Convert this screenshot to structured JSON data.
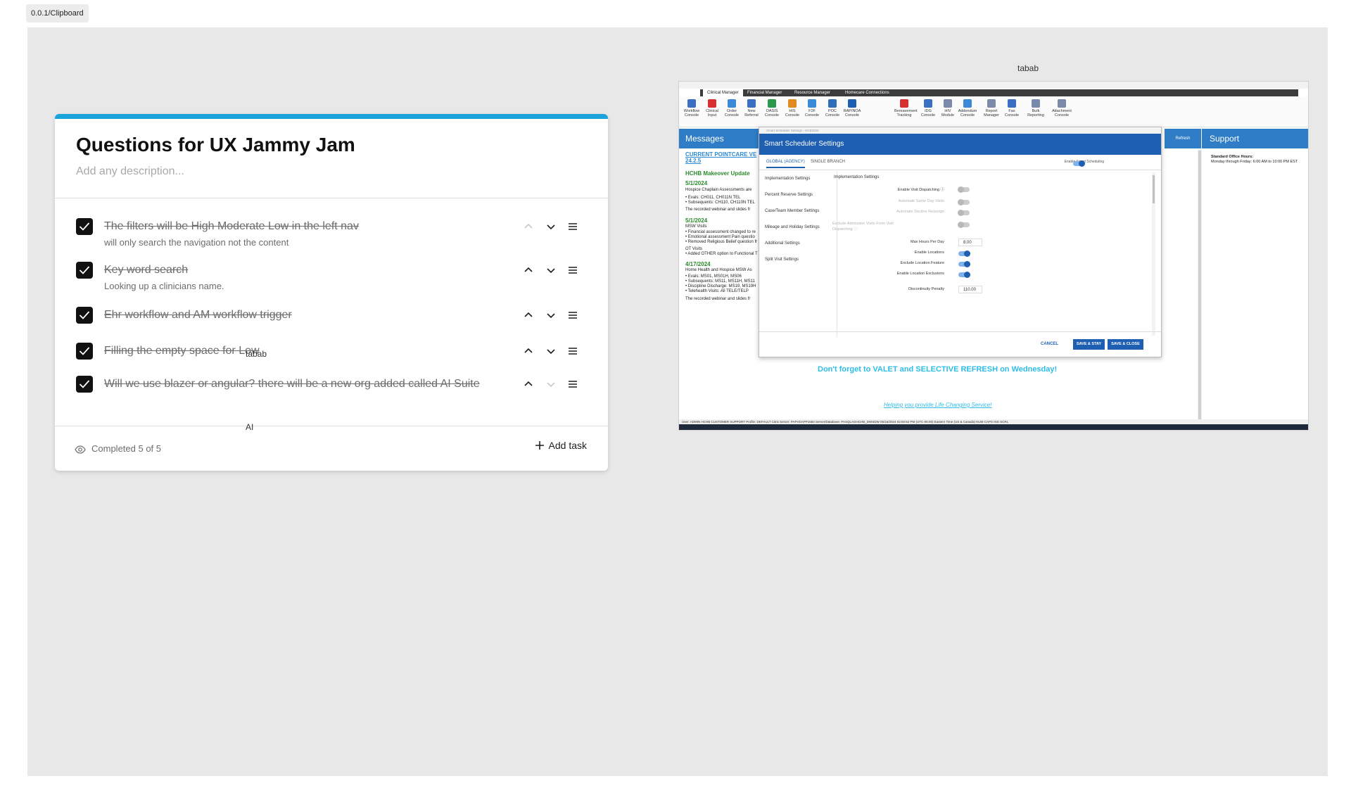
{
  "frame_label": "0.0.1/Clipboard",
  "stray_labels": {
    "top": "tabab",
    "mid": "tabab",
    "ai": "AI"
  },
  "card": {
    "title": "Questions for UX Jammy Jam",
    "description_placeholder": "Add any description...",
    "tasks": [
      {
        "title": "The filters will be High Moderate Low in the left nav",
        "note": "will only search the navigation not the content",
        "checked": true
      },
      {
        "title": "Key word search",
        "note": "Looking up a clinicians name.",
        "checked": true
      },
      {
        "title": "Ehr workflow and AM  workflow trigger",
        "note": "",
        "checked": true
      },
      {
        "title": "Filling the empty space for Low",
        "note": "",
        "checked": true
      },
      {
        "title": "Will we use blazer or angular? there will be a new org added called AI Suite",
        "note": "",
        "checked": true
      }
    ],
    "footer": {
      "completed": "Completed 5 of 5",
      "add_task": "Add task"
    },
    "icons": {
      "move_up": "chevron-up-icon",
      "move_down": "chevron-down-icon",
      "menu": "hamburger-menu-icon",
      "visibility": "eye-icon",
      "add": "plus-icon"
    }
  },
  "screenshot": {
    "tabs": [
      "Clinical Manager",
      "Financial Manager",
      "Resource Manager",
      "Homecare Connections"
    ],
    "ribbon": [
      {
        "label": "Workflow Console",
        "color": "#3b6fc4"
      },
      {
        "label": "Clinical Input",
        "color": "#d83030"
      },
      {
        "label": "Order Console",
        "color": "#3b8ad8"
      },
      {
        "label": "New Referral",
        "color": "#3b6fc4"
      },
      {
        "label": "OASIS Console",
        "color": "#2a9a4a"
      },
      {
        "label": "HIS Console",
        "color": "#e08a20"
      },
      {
        "label": "F2F Console",
        "color": "#3b8ad8"
      },
      {
        "label": "POC Console",
        "color": "#2f6fb8"
      },
      {
        "label": "RAP/NOA Console",
        "color": "#1f5fb1"
      },
      {
        "label": "Bereavement Tracking",
        "color": "#d83030"
      },
      {
        "label": "IDG Console",
        "color": "#3b6fc4"
      },
      {
        "label": "HIV Module",
        "color": "#7a8aa8"
      },
      {
        "label": "Addendum Console",
        "color": "#3b8ad8"
      },
      {
        "label": "Report Manager",
        "color": "#7a8aa8"
      },
      {
        "label": "Fax Console",
        "color": "#3b6fc4"
      },
      {
        "label": "Bulk Reporting",
        "color": "#7a8aa8"
      },
      {
        "label": "Attachment Console",
        "color": "#7a8aa8"
      }
    ],
    "messages_header": "Messages",
    "refresh": "Refresh",
    "support_header": "Support",
    "support_lines": [
      "Standard Office Hours:",
      "Monday through Friday: 6:00 AM to 10:00 PM EST"
    ],
    "messages": [
      {
        "text": "CURRENT POINTCARE VE",
        "style": "blue"
      },
      {
        "text": "24.2.5",
        "style": "blue"
      },
      {
        "text": "HCHB Makeover Update",
        "style": "green"
      },
      {
        "text": "5/1/2024",
        "style": "green"
      },
      {
        "text": "Hospice Chaplain Assessments are",
        "style": "plain"
      },
      {
        "text": "• Evals: CH011, CH011N TEL",
        "style": "plain"
      },
      {
        "text": "• Subsequents: CH110, CH110N TEL",
        "style": "plain"
      },
      {
        "text": "The recorded webinar and slides fr",
        "style": "plain"
      },
      {
        "text": "5/1/2024",
        "style": "green"
      },
      {
        "text": "MSW Visits",
        "style": "plain"
      },
      {
        "text": "• Financial assessment changed to re",
        "style": "plain"
      },
      {
        "text": "• Emotional assessment Pain questio",
        "style": "plain"
      },
      {
        "text": "• Removed Religious Belief question fr",
        "style": "plain"
      },
      {
        "text": "OT Visits",
        "style": "plain"
      },
      {
        "text": "• Added OTHER option to Functional T",
        "style": "plain"
      },
      {
        "text": "4/17/2024",
        "style": "green"
      },
      {
        "text": "Home Health and Hospice MSW As",
        "style": "plain"
      },
      {
        "text": "• Evals: MS01, MS01H, MS06",
        "style": "plain"
      },
      {
        "text": "• Subsequents: MS11, MS11H, MS11",
        "style": "plain"
      },
      {
        "text": "• Discipline Discharge: MS19, MS19H",
        "style": "plain"
      },
      {
        "text": "• Telehealth Visits: All TELE/TELP",
        "style": "plain"
      },
      {
        "text": "The recorded webinar and slides fr",
        "style": "plain"
      }
    ],
    "reminder": "Don't forget to VALET and SELECTIVE REFRESH on Wednesday!",
    "tagline": "Helping you provide Life Changing Service!",
    "status_bar": "User: ADMIN HCHB  CUSTOMER SUPPORT   Profile: DEFAULT   Citrix Server: PAPVDAPP1560   Server/Database: PASQLAGHCHB_DWSDW   05/16/2024 02:50:52 PM (UTC-05:00) Eastern Time (US & Canada)   NUM   CAPS   INS   SCRL",
    "dialog": {
      "window_title": "Smart Scheduler Settings - HCB2024",
      "header": "Smart Scheduler Settings",
      "tabs": [
        "GLOBAL (AGENCY)",
        "SINGLE BRANCH"
      ],
      "enable_label": "Enable Smart Scheduling",
      "menu": [
        "Implementation Settings",
        "Percent Reserve Settings",
        "Case/Team Member Settings",
        "Mileage and Holiday Settings",
        "Additional Settings",
        "Split Visit Settings"
      ],
      "section": "Implementation Settings",
      "settings": [
        {
          "label": "Enable Visit Dispatching ⓘ",
          "kind": "toggle",
          "on": false,
          "dim": false
        },
        {
          "label": "Automate Same Day Visits",
          "kind": "toggle",
          "on": false,
          "dim": true
        },
        {
          "label": "Automate Decline Reassign",
          "kind": "toggle",
          "on": false,
          "dim": true
        },
        {
          "label": "Exclude Admission Visits From Visit Dispatching ⓘ",
          "kind": "toggle",
          "on": false,
          "dim": true
        },
        {
          "label": "Max Hours Per Day",
          "kind": "value",
          "value": "8.00",
          "dim": false
        },
        {
          "label": "Enable Locations",
          "kind": "toggle",
          "on": true,
          "dim": false
        },
        {
          "label": "Exclude Location Feature",
          "kind": "toggle",
          "on": true,
          "dim": false
        },
        {
          "label": "Enable Location Exclusions",
          "kind": "toggle",
          "on": true,
          "dim": false
        },
        {
          "label": "Discontinuity Penalty",
          "kind": "value",
          "value": "110.00",
          "dim": false
        }
      ],
      "buttons": {
        "cancel": "CANCEL",
        "save_stay": "SAVE & STAY",
        "save_close": "SAVE & CLOSE"
      }
    }
  }
}
